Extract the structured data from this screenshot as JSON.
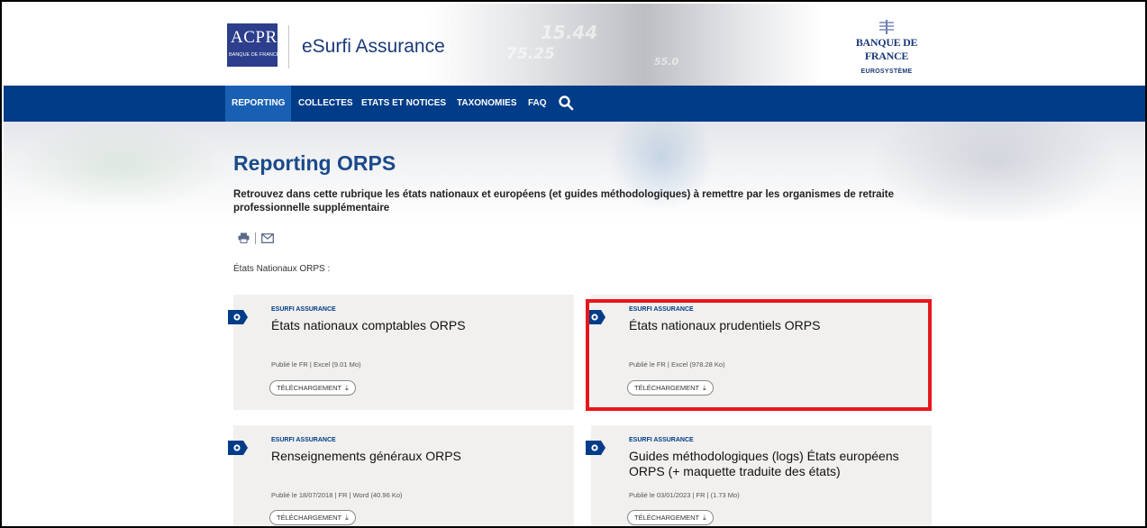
{
  "header": {
    "logo_acpr_text": "ACPR",
    "logo_acpr_sub": "BANQUE DE FRANCE",
    "site_title": "eSurfi Assurance",
    "bdf_name": "BANQUE DE FRANCE",
    "bdf_euro": "EUROSYSTÈME",
    "photo_numbers": [
      "15.44",
      "75.25",
      "55.0"
    ]
  },
  "nav": {
    "items": [
      {
        "label": "REPORTING",
        "active": true
      },
      {
        "label": "COLLECTES",
        "active": false
      },
      {
        "label": "ETATS ET NOTICES",
        "active": false
      },
      {
        "label": "TAXONOMIES",
        "active": false
      },
      {
        "label": "FAQ",
        "active": false
      }
    ],
    "search_icon": "search-icon"
  },
  "page": {
    "title": "Reporting ORPS",
    "description": "Retrouvez dans cette rubrique les états nationaux et européens (et guides méthodologiques) à remettre par les organismes de retraite professionnelle supplémentaire",
    "section_label": "États Nationaux ORPS :"
  },
  "cards": [
    {
      "kicker": "ESURFI ASSURANCE",
      "title": "États nationaux comptables ORPS",
      "meta": "Publié le                   FR  |  Excel (9.01 Mo)",
      "button": "TÉLÉCHARGEMENT"
    },
    {
      "kicker": "ESURFI ASSURANCE",
      "title": "États nationaux prudentiels ORPS",
      "meta": "Publié le                         FR  |  Excel (978.28 Ko)",
      "button": "TÉLÉCHARGEMENT"
    },
    {
      "kicker": "ESURFI ASSURANCE",
      "title": "Renseignements généraux ORPS",
      "meta": "Publié le 18/07/2018  |  FR  |  Word (40.96 Ko)",
      "button": "TÉLÉCHARGEMENT"
    },
    {
      "kicker": "ESURFI ASSURANCE",
      "title": "Guides méthodologiques (logs) États européens ORPS (+ maquette traduite des états)",
      "meta": "Publié le 03/01/2023  |  FR  |  (1.73 Mo)",
      "button": "TÉLÉCHARGEMENT"
    }
  ],
  "colors": {
    "nav_bg": "#003c88",
    "nav_active": "#1960b5",
    "title_blue": "#1a4a8a",
    "card_bg": "#f1f0ee",
    "highlight": "#e8161c"
  }
}
